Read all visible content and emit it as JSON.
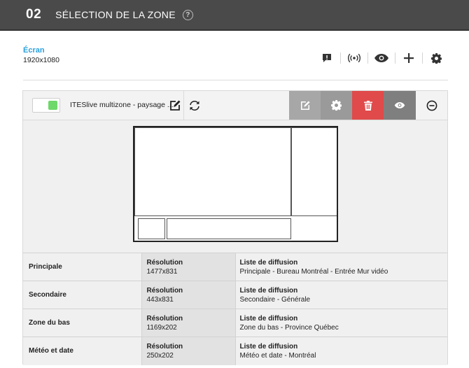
{
  "header": {
    "step_number": "02",
    "title": "SÉLECTION DE LA ZONE",
    "help_icon": "question-circle-icon"
  },
  "screen": {
    "label": "Écran",
    "resolution": "1920x1080"
  },
  "toolbar": {
    "icons": [
      "alert-icon",
      "broadcast-icon",
      "eye-icon",
      "plus-icon",
      "gear-icon"
    ]
  },
  "layout": {
    "enabled": true,
    "toggle_color": "#6ed86a",
    "name": "ITESlive multizone - paysage ...",
    "actions": [
      {
        "name": "edit",
        "icon": "edit-icon",
        "color": "#a7a7a7"
      },
      {
        "name": "settings",
        "icon": "gear-icon",
        "color": "#9a9a9a"
      },
      {
        "name": "delete",
        "icon": "trash-icon",
        "color": "#e04a4a"
      },
      {
        "name": "preview",
        "icon": "eye-icon",
        "color": "#7f7f7f"
      },
      {
        "name": "collapse",
        "icon": "minus-circle-icon",
        "color": "#f3f3f3"
      }
    ]
  },
  "zones": [
    {
      "name": "Principale",
      "resolution_label": "Résolution",
      "resolution": "1477x831",
      "playlist_label": "Liste de diffusion",
      "playlist": "Principale - Bureau Montréal - Entrée Mur vidéo"
    },
    {
      "name": "Secondaire",
      "resolution_label": "Résolution",
      "resolution": "443x831",
      "playlist_label": "Liste de diffusion",
      "playlist": "Secondaire - Générale"
    },
    {
      "name": "Zone du bas",
      "resolution_label": "Résolution",
      "resolution": "1169x202",
      "playlist_label": "Liste de diffusion",
      "playlist": "Zone du bas - Province Québec"
    },
    {
      "name": "Météo et date",
      "resolution_label": "Résolution",
      "resolution": "250x202",
      "playlist_label": "Liste de diffusion",
      "playlist": "Météo et date - Montréal"
    }
  ]
}
